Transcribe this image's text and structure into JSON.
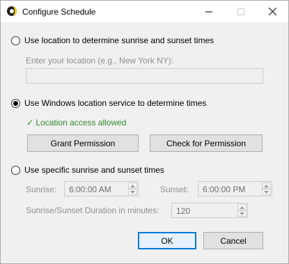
{
  "window": {
    "title": "Configure Schedule",
    "icons": {
      "app": "app-sun-moon-icon",
      "minimize": "minimize-icon",
      "maximize": "maximize-icon",
      "close": "close-icon"
    }
  },
  "options": {
    "location": {
      "label": "Use location to determine sunrise and sunset times",
      "input_label": "Enter your location (e.g., New York NY):",
      "input_value": "",
      "selected": false
    },
    "windows_location": {
      "label": "Use Windows location service to determine times",
      "selected": true,
      "status": "✓ Location access allowed",
      "grant_button": "Grant Permission",
      "check_button": "Check for Permission"
    },
    "specific": {
      "label": "Use specific sunrise and sunset times",
      "selected": false,
      "sunrise_label": "Sunrise:",
      "sunrise_value": "6:00:00 AM",
      "sunset_label": "Sunset:",
      "sunset_value": "6:00:00 PM",
      "duration_label": "Sunrise/Sunset Duration in minutes:",
      "duration_value": "120"
    }
  },
  "footer": {
    "ok_label": "OK",
    "cancel_label": "Cancel"
  },
  "colors": {
    "status_ok": "#2f8a2f",
    "accent": "#0078d7"
  }
}
